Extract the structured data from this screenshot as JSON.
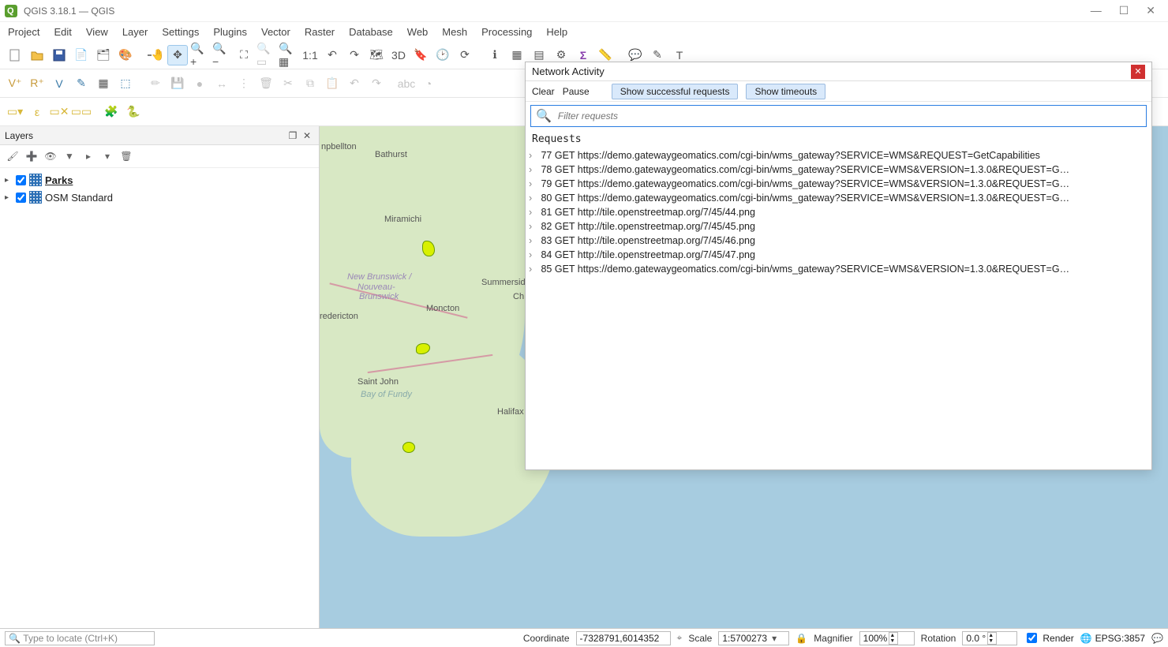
{
  "title": "QGIS 3.18.1 — QGIS",
  "menu": [
    "Project",
    "Edit",
    "View",
    "Layer",
    "Settings",
    "Plugins",
    "Vector",
    "Raster",
    "Database",
    "Web",
    "Mesh",
    "Processing",
    "Help"
  ],
  "layers_panel": {
    "title": "Layers",
    "items": [
      {
        "label": "Parks",
        "checked": true,
        "active": true
      },
      {
        "label": "OSM Standard",
        "checked": true,
        "active": false
      }
    ]
  },
  "map_labels": [
    "npbellton",
    "Bathurst",
    "Miramichi",
    "New Brunswick /",
    "Nouveau-",
    "Brunswick",
    "redericton",
    "Moncton",
    "Saint John",
    "Bay of Fundy",
    "Summerside",
    "Ch",
    "Halifax"
  ],
  "network": {
    "title": "Network Activity",
    "buttons": {
      "clear": "Clear",
      "pause": "Pause",
      "success": "Show successful requests",
      "timeouts": "Show timeouts"
    },
    "filter_placeholder": "Filter requests",
    "requests_label": "Requests",
    "rows": [
      {
        "id": "77",
        "method": "GET",
        "url": "https://demo.gatewaygeomatics.com/cgi-bin/wms_gateway?SERVICE=WMS&REQUEST=GetCapabilities"
      },
      {
        "id": "78",
        "method": "GET",
        "url": "https://demo.gatewaygeomatics.com/cgi-bin/wms_gateway?SERVICE=WMS&VERSION=1.3.0&REQUEST=G…"
      },
      {
        "id": "79",
        "method": "GET",
        "url": "https://demo.gatewaygeomatics.com/cgi-bin/wms_gateway?SERVICE=WMS&VERSION=1.3.0&REQUEST=G…"
      },
      {
        "id": "80",
        "method": "GET",
        "url": "https://demo.gatewaygeomatics.com/cgi-bin/wms_gateway?SERVICE=WMS&VERSION=1.3.0&REQUEST=G…"
      },
      {
        "id": "81",
        "method": "GET",
        "url": "http://tile.openstreetmap.org/7/45/44.png"
      },
      {
        "id": "82",
        "method": "GET",
        "url": "http://tile.openstreetmap.org/7/45/45.png"
      },
      {
        "id": "83",
        "method": "GET",
        "url": "http://tile.openstreetmap.org/7/45/46.png"
      },
      {
        "id": "84",
        "method": "GET",
        "url": "http://tile.openstreetmap.org/7/45/47.png"
      },
      {
        "id": "85",
        "method": "GET",
        "url": "https://demo.gatewaygeomatics.com/cgi-bin/wms_gateway?SERVICE=WMS&VERSION=1.3.0&REQUEST=G…"
      }
    ]
  },
  "status": {
    "locate_placeholder": "Type to locate (Ctrl+K)",
    "coord_label": "Coordinate",
    "coord": "-7328791,6014352",
    "scale_label": "Scale",
    "scale": "1:5700273",
    "mag_label": "Magnifier",
    "mag": "100%",
    "rot_label": "Rotation",
    "rot": "0.0 °",
    "render": "Render",
    "crs": "EPSG:3857"
  }
}
